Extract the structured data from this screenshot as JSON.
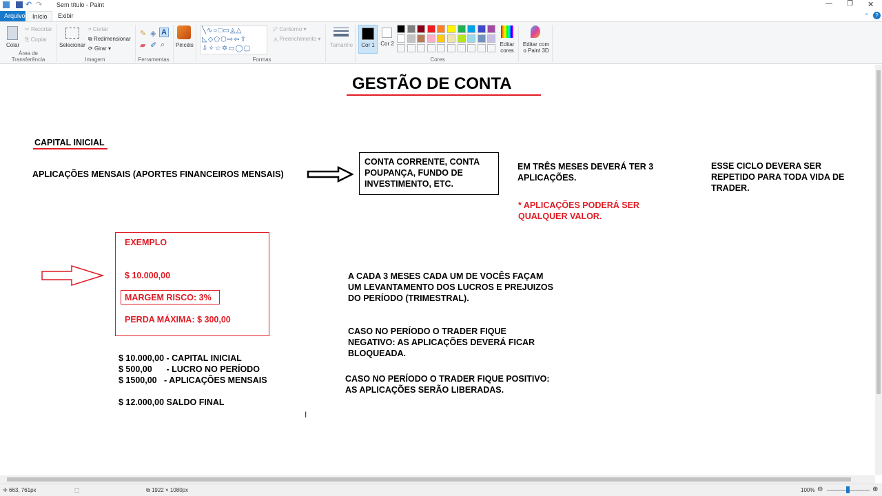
{
  "window": {
    "title": "Sem título - Paint"
  },
  "tabs": [
    "Arquivo",
    "Início",
    "Exibir"
  ],
  "ribbon": {
    "clipboard": {
      "paste": "Colar",
      "cut": "Recortar",
      "copy": "Copiar",
      "group": "Área de Transferência"
    },
    "image": {
      "select": "Selecionar",
      "crop": "Cortar",
      "resize": "Redimensionar",
      "rotate": "Girar",
      "group": "Imagem"
    },
    "tools": {
      "group": "Ferramentas"
    },
    "brushes": "Pincéis",
    "shapes": {
      "outline": "Contorno",
      "fill": "Preenchimento",
      "group": "Formas"
    },
    "size": "Tamanho",
    "color1": "Cor 1",
    "color2": "Cor 2",
    "edit_colors": "Editar cores",
    "paint3d": "Editar com o Paint 3D",
    "colors_group": "Cores",
    "palette": [
      "#000000",
      "#7f7f7f",
      "#880015",
      "#ed1c24",
      "#ff7f27",
      "#fff200",
      "#22b14c",
      "#00a2e8",
      "#3f48cc",
      "#a349a4",
      "#ffffff",
      "#c3c3c3",
      "#b97a57",
      "#ffaec9",
      "#ffc90e",
      "#efe4b0",
      "#b5e61d",
      "#99d9ea",
      "#7092be",
      "#c8bfe7"
    ]
  },
  "canvas": {
    "title": "GESTÃO DE CONTA",
    "capital": "CAPITAL INICIAL",
    "aplicacoes": "APLICAÇÕES MENSAIS (APORTES FINANCEIROS MENSAIS)",
    "conta_box": [
      "CONTA CORRENTE, CONTA",
      "POUPANÇA, FUNDO DE",
      "INVESTIMENTO, ETC."
    ],
    "tres_meses": [
      "EM TRÊS MESES DEVERÁ TER 3",
      "APLICAÇÕES."
    ],
    "ciclo": [
      "ESSE CICLO DEVERA SER",
      "REPETIDO PARA TODA VIDA DE",
      "TRADER."
    ],
    "nota": [
      "* APLICAÇÕES PODERÁ SER",
      "QUALQUER VALOR."
    ],
    "exemplo": "EXEMPLO",
    "valor": "$ 10.000,00",
    "margem": "MARGEM RISCO: 3%",
    "perda": "PERDA MÁXIMA: $ 300,00",
    "calc": [
      "$ 10.000,00 - CAPITAL INICIAL",
      "$ 500,00      - LUCRO NO PERÍODO",
      "$ 1500,00   - APLICAÇÕES MENSAIS"
    ],
    "saldo": "$ 12.000,00 SALDO FINAL",
    "cada3": [
      "A CADA 3 MESES CADA UM DE VOCÊS FAÇAM",
      "UM LEVANTAMENTO DOS LUCROS E PREJUIZOS",
      "DO PERÍODO (TRIMESTRAL)."
    ],
    "negativo": [
      "CASO NO PERÍODO O TRADER FIQUE",
      "NEGATIVO: AS APLICAÇÕES DEVERÁ FICAR",
      "BLOQUEADA."
    ],
    "positivo": [
      "CASO NO PERÍODO O TRADER FIQUE POSITIVO:",
      "AS APLICAÇÕES SERÃO LIBERADAS."
    ]
  },
  "status": {
    "cursor": "663, 761px",
    "size": "1922 × 1080px",
    "zoom": "100%"
  }
}
